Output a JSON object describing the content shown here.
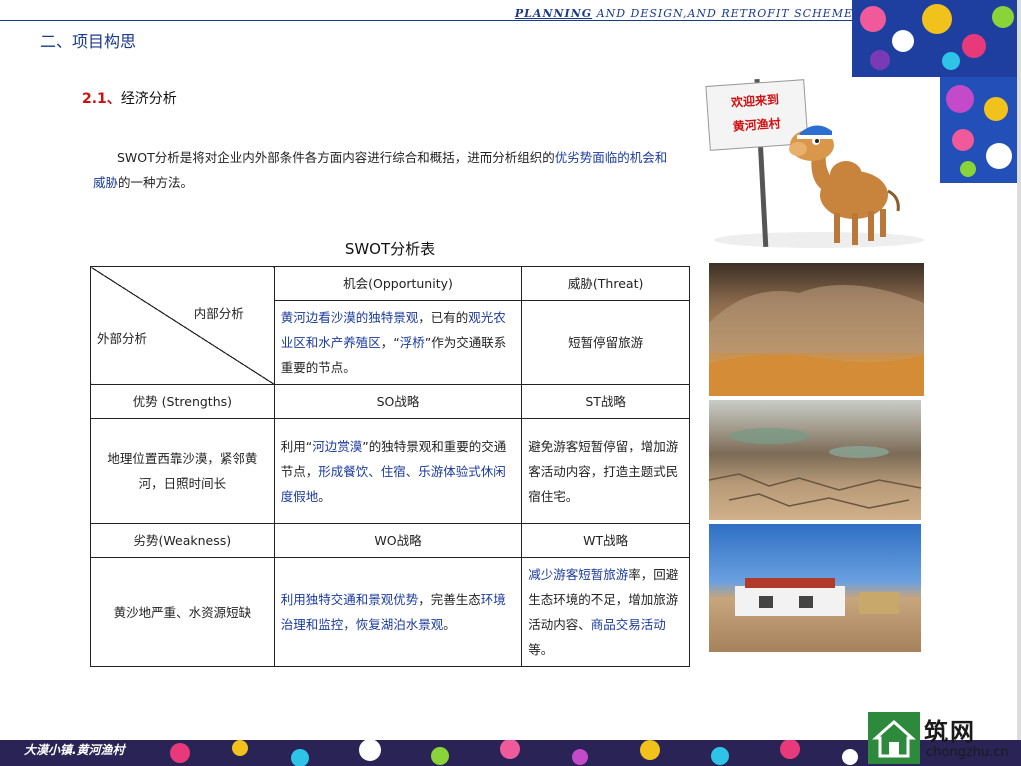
{
  "header": {
    "title_first": "PLANNING",
    "title_rest": " AND DESIGN,AND RETROFIT SCHEME"
  },
  "section": {
    "title": "二、项目构思"
  },
  "subsection": {
    "number": "2.1、",
    "title": "经济分析"
  },
  "intro": {
    "part1": "SWOT分析是将对企业内外部条件各方面内容进行综合和概括，进而分析组织的",
    "part2_hl": "优劣势面临的机会和威胁",
    "part3": "的一种方法。"
  },
  "table": {
    "caption": "SWOT分析表",
    "corner_top": "内部分析",
    "corner_bottom": "外部分析",
    "col_opportunity": "机会(Opportunity)",
    "col_threat": "威胁(Threat)",
    "opportunity": {
      "hl1": "黄河边看沙漠的独特景观",
      "t1": "，已有的",
      "hl2": "观光农业区和水产养殖区",
      "t2": "，“",
      "hl3": "浮桥",
      "t3": "”作为交通联系重要的节点。"
    },
    "threat": "短暂停留旅游",
    "row_strengths": "优势 (Strengths)",
    "so_label": "SO战略",
    "st_label": "ST战略",
    "strengths": "地理位置西靠沙漠，紧邻黄河，日照时间长",
    "so": {
      "t1": "利用“",
      "hl1": "河边赏漠",
      "t2": "”的独特景观和重要的交通节点，",
      "hl2": "形成餐饮、住宿、乐游体验式休闲度假地",
      "t3": "。"
    },
    "st": "避免游客短暂停留，增加游客活动内容，打造主题式民宿住宅。",
    "row_weakness": "劣势(Weakness)",
    "wo_label": "WO战略",
    "wt_label": "WT战略",
    "weakness": "黄沙地严重、水资源短缺",
    "wo": {
      "hl1": "利用独特交通和景观优势",
      "t1": "，完善生态",
      "hl2": "环境治理和监控，恢复湖泊水景观",
      "t2": "。"
    },
    "wt": {
      "hl1": "减少游客短暂旅游",
      "t1": "率，回避生态环境的不足，增加旅游活动内容、",
      "hl2": "商品交易活动",
      "t2": "等。"
    }
  },
  "sign": {
    "line1": "欢迎来到",
    "line2": "黄河渔村"
  },
  "footer": {
    "label": "大漠小镇.黄河渔村"
  },
  "logo": {
    "cn": "筑网",
    "en": "chongzhu.cn"
  },
  "colors": {
    "accent_blue": "#1a3a8a",
    "highlight_blue": "#1a3a9c",
    "number_red": "#d01010"
  }
}
